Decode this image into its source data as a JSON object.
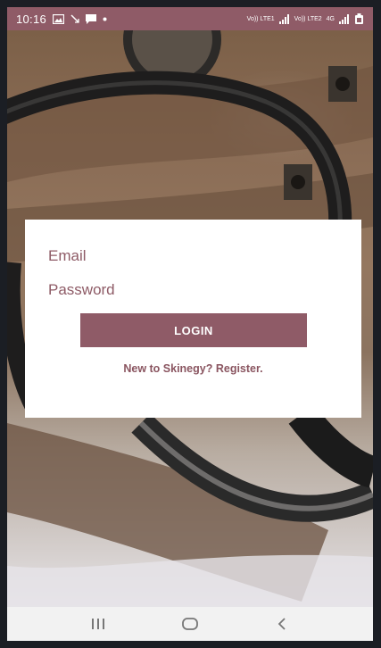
{
  "status_bar": {
    "time": "10:16",
    "left_icons": [
      "gallery-icon",
      "missed-call-icon",
      "message-icon",
      "dot-icon"
    ],
    "right_icons": [
      "volte-lte-icon",
      "signal-icon",
      "volte-lte-icon",
      "signal-icon",
      "battery-icon"
    ],
    "volte_label_1": "Vo)) LTE1",
    "volte_label_2": "Vo)) LTE2",
    "network_label": "4G",
    "color": "#8f5b67"
  },
  "login": {
    "email_placeholder": "Email",
    "password_placeholder": "Password",
    "login_label": "LOGIN",
    "register_label": "New to Skinegy? Register."
  },
  "nav_bar": {
    "buttons": [
      "recents-icon",
      "home-icon",
      "back-icon"
    ]
  },
  "colors": {
    "accent": "#8f5b67",
    "card": "#ffffff",
    "nav": "#f2f2f2"
  }
}
